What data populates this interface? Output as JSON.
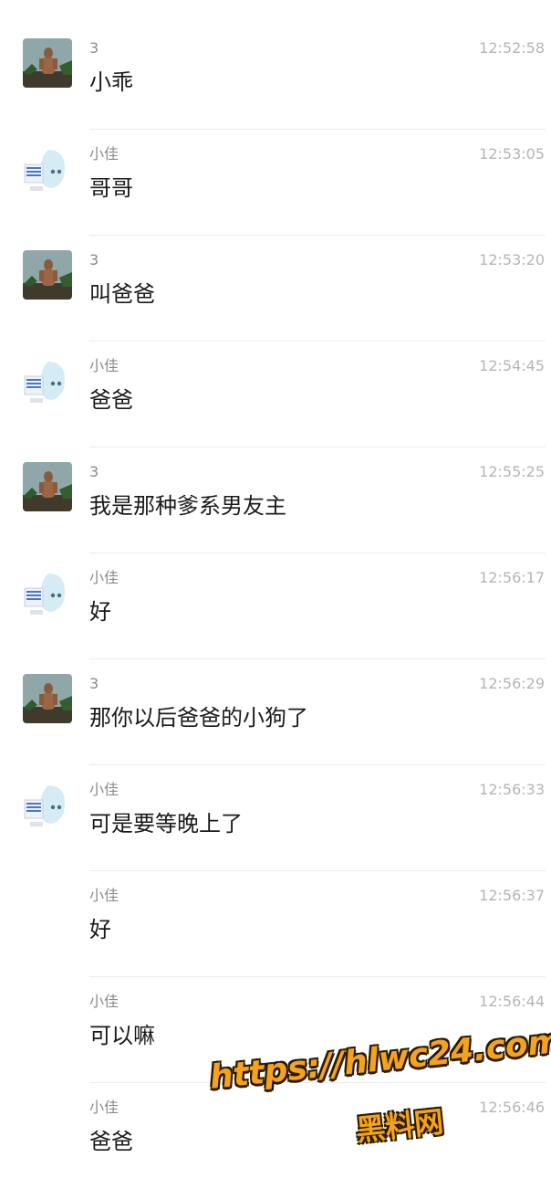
{
  "messages": [
    {
      "sender": "3",
      "time": "12:52:58",
      "text": "小乖",
      "avatar": "man-photo-avatar"
    },
    {
      "sender": "小佳",
      "time": "12:53:05",
      "text": "哥哥",
      "avatar": "anime-sticker-avatar"
    },
    {
      "sender": "3",
      "time": "12:53:20",
      "text": "叫爸爸",
      "avatar": "man-photo-avatar"
    },
    {
      "sender": "小佳",
      "time": "12:54:45",
      "text": "爸爸",
      "avatar": "anime-sticker-avatar"
    },
    {
      "sender": "3",
      "time": "12:55:25",
      "text": "我是那种爹系男友主",
      "avatar": "man-photo-avatar"
    },
    {
      "sender": "小佳",
      "time": "12:56:17",
      "text": "好",
      "avatar": "anime-sticker-avatar"
    },
    {
      "sender": "3",
      "time": "12:56:29",
      "text": "那你以后爸爸的小狗了",
      "avatar": "man-photo-avatar"
    },
    {
      "sender": "小佳",
      "time": "12:56:33",
      "text": "可是要等晚上了",
      "avatar": "anime-sticker-avatar"
    },
    {
      "sender": "小佳",
      "time": "12:56:37",
      "text": "好",
      "avatar": null
    },
    {
      "sender": "小佳",
      "time": "12:56:44",
      "text": "可以嘛",
      "avatar": null
    },
    {
      "sender": "小佳",
      "time": "12:56:46",
      "text": "爸爸",
      "avatar": null
    }
  ],
  "watermark": {
    "url": "https://hlwc24.com",
    "name": "黑料网",
    "color": "#f5a21c"
  },
  "colors": {
    "name": "#8a8a8a",
    "time": "#b5b5b5",
    "text": "#1a1a1a",
    "divider": "#ececec"
  }
}
